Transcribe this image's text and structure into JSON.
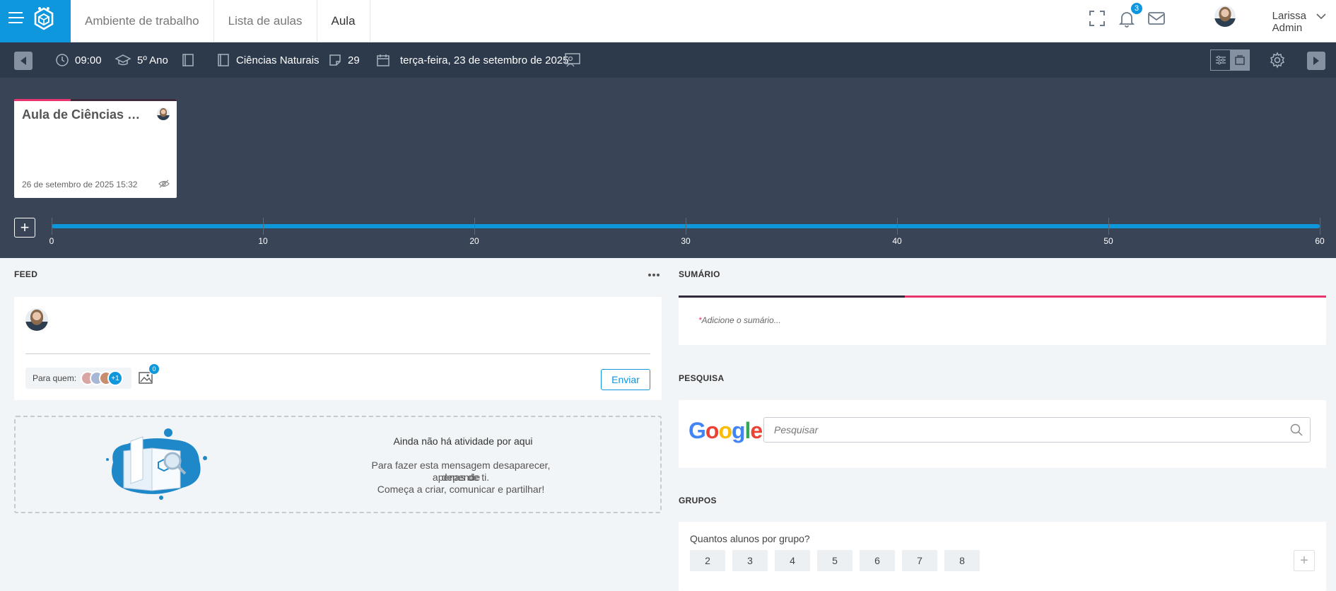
{
  "header": {
    "tabs": [
      {
        "label": "Ambiente de trabalho"
      },
      {
        "label": "Lista de aulas"
      },
      {
        "label": "Aula"
      }
    ],
    "notifications_count": "3",
    "user_name": "Larissa Admin"
  },
  "lesson_bar": {
    "time": "09:00",
    "grade": "5º Ano",
    "subject": "Ciências Naturais",
    "count": "29",
    "date": "terça-feira, 23 de setembro de 2025"
  },
  "timeline": {
    "card": {
      "title": "Aula de Ciências Naturais",
      "date": "26 de setembro de 2025 15:32"
    },
    "ticks": [
      "0",
      "10",
      "20",
      "30",
      "40",
      "50",
      "60"
    ],
    "progress": 1.0
  },
  "feed": {
    "title": "FEED",
    "to_label": "Para quem:",
    "more_recipients": "+1",
    "images_count": "0",
    "send_label": "Enviar",
    "empty": {
      "title": "Ainda não há atividade por aqui",
      "line1": "Para fazer esta mensagem desaparecer, depende",
      "line2": "apenas de ti.",
      "line3": "Começa a criar, comunicar e partilhar!"
    }
  },
  "summary": {
    "title": "SUMÁRIO",
    "required_mark": "*",
    "placeholder": "Adicione o sumário..."
  },
  "research": {
    "title": "PESQUISA",
    "google_letters": [
      "G",
      "o",
      "o",
      "g",
      "l",
      "e"
    ],
    "placeholder": "Pesquisar"
  },
  "groups": {
    "title": "GRUPOS",
    "question": "Quantos alunos por grupo?",
    "options": [
      "2",
      "3",
      "4",
      "5",
      "6",
      "7",
      "8"
    ],
    "add_label": "+"
  },
  "colors": {
    "primary": "#0e97dd",
    "toolbar": "#2d3a4b",
    "timeline_bg": "#394556",
    "accent_pink": "#e6356f"
  }
}
